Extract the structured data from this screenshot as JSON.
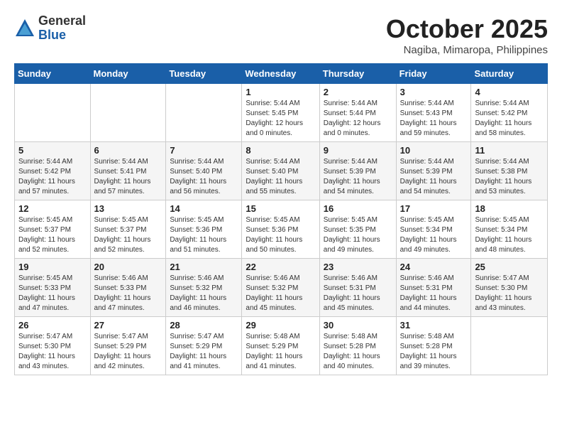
{
  "header": {
    "logo_general": "General",
    "logo_blue": "Blue",
    "month_title": "October 2025",
    "location": "Nagiba, Mimaropa, Philippines"
  },
  "weekdays": [
    "Sunday",
    "Monday",
    "Tuesday",
    "Wednesday",
    "Thursday",
    "Friday",
    "Saturday"
  ],
  "weeks": [
    [
      {
        "day": "",
        "info": ""
      },
      {
        "day": "",
        "info": ""
      },
      {
        "day": "",
        "info": ""
      },
      {
        "day": "1",
        "info": "Sunrise: 5:44 AM\nSunset: 5:45 PM\nDaylight: 12 hours\nand 0 minutes."
      },
      {
        "day": "2",
        "info": "Sunrise: 5:44 AM\nSunset: 5:44 PM\nDaylight: 12 hours\nand 0 minutes."
      },
      {
        "day": "3",
        "info": "Sunrise: 5:44 AM\nSunset: 5:43 PM\nDaylight: 11 hours\nand 59 minutes."
      },
      {
        "day": "4",
        "info": "Sunrise: 5:44 AM\nSunset: 5:42 PM\nDaylight: 11 hours\nand 58 minutes."
      }
    ],
    [
      {
        "day": "5",
        "info": "Sunrise: 5:44 AM\nSunset: 5:42 PM\nDaylight: 11 hours\nand 57 minutes."
      },
      {
        "day": "6",
        "info": "Sunrise: 5:44 AM\nSunset: 5:41 PM\nDaylight: 11 hours\nand 57 minutes."
      },
      {
        "day": "7",
        "info": "Sunrise: 5:44 AM\nSunset: 5:40 PM\nDaylight: 11 hours\nand 56 minutes."
      },
      {
        "day": "8",
        "info": "Sunrise: 5:44 AM\nSunset: 5:40 PM\nDaylight: 11 hours\nand 55 minutes."
      },
      {
        "day": "9",
        "info": "Sunrise: 5:44 AM\nSunset: 5:39 PM\nDaylight: 11 hours\nand 54 minutes."
      },
      {
        "day": "10",
        "info": "Sunrise: 5:44 AM\nSunset: 5:39 PM\nDaylight: 11 hours\nand 54 minutes."
      },
      {
        "day": "11",
        "info": "Sunrise: 5:44 AM\nSunset: 5:38 PM\nDaylight: 11 hours\nand 53 minutes."
      }
    ],
    [
      {
        "day": "12",
        "info": "Sunrise: 5:45 AM\nSunset: 5:37 PM\nDaylight: 11 hours\nand 52 minutes."
      },
      {
        "day": "13",
        "info": "Sunrise: 5:45 AM\nSunset: 5:37 PM\nDaylight: 11 hours\nand 52 minutes."
      },
      {
        "day": "14",
        "info": "Sunrise: 5:45 AM\nSunset: 5:36 PM\nDaylight: 11 hours\nand 51 minutes."
      },
      {
        "day": "15",
        "info": "Sunrise: 5:45 AM\nSunset: 5:36 PM\nDaylight: 11 hours\nand 50 minutes."
      },
      {
        "day": "16",
        "info": "Sunrise: 5:45 AM\nSunset: 5:35 PM\nDaylight: 11 hours\nand 49 minutes."
      },
      {
        "day": "17",
        "info": "Sunrise: 5:45 AM\nSunset: 5:34 PM\nDaylight: 11 hours\nand 49 minutes."
      },
      {
        "day": "18",
        "info": "Sunrise: 5:45 AM\nSunset: 5:34 PM\nDaylight: 11 hours\nand 48 minutes."
      }
    ],
    [
      {
        "day": "19",
        "info": "Sunrise: 5:45 AM\nSunset: 5:33 PM\nDaylight: 11 hours\nand 47 minutes."
      },
      {
        "day": "20",
        "info": "Sunrise: 5:46 AM\nSunset: 5:33 PM\nDaylight: 11 hours\nand 47 minutes."
      },
      {
        "day": "21",
        "info": "Sunrise: 5:46 AM\nSunset: 5:32 PM\nDaylight: 11 hours\nand 46 minutes."
      },
      {
        "day": "22",
        "info": "Sunrise: 5:46 AM\nSunset: 5:32 PM\nDaylight: 11 hours\nand 45 minutes."
      },
      {
        "day": "23",
        "info": "Sunrise: 5:46 AM\nSunset: 5:31 PM\nDaylight: 11 hours\nand 45 minutes."
      },
      {
        "day": "24",
        "info": "Sunrise: 5:46 AM\nSunset: 5:31 PM\nDaylight: 11 hours\nand 44 minutes."
      },
      {
        "day": "25",
        "info": "Sunrise: 5:47 AM\nSunset: 5:30 PM\nDaylight: 11 hours\nand 43 minutes."
      }
    ],
    [
      {
        "day": "26",
        "info": "Sunrise: 5:47 AM\nSunset: 5:30 PM\nDaylight: 11 hours\nand 43 minutes."
      },
      {
        "day": "27",
        "info": "Sunrise: 5:47 AM\nSunset: 5:29 PM\nDaylight: 11 hours\nand 42 minutes."
      },
      {
        "day": "28",
        "info": "Sunrise: 5:47 AM\nSunset: 5:29 PM\nDaylight: 11 hours\nand 41 minutes."
      },
      {
        "day": "29",
        "info": "Sunrise: 5:48 AM\nSunset: 5:29 PM\nDaylight: 11 hours\nand 41 minutes."
      },
      {
        "day": "30",
        "info": "Sunrise: 5:48 AM\nSunset: 5:28 PM\nDaylight: 11 hours\nand 40 minutes."
      },
      {
        "day": "31",
        "info": "Sunrise: 5:48 AM\nSunset: 5:28 PM\nDaylight: 11 hours\nand 39 minutes."
      },
      {
        "day": "",
        "info": ""
      }
    ]
  ]
}
